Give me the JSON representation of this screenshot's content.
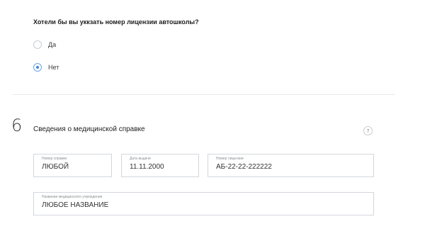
{
  "question": {
    "text": "Хотели бы вы уккзать номер лицензии автошколы?",
    "options": [
      {
        "label": "Да",
        "checked": false
      },
      {
        "label": "Нет",
        "checked": true
      }
    ]
  },
  "section": {
    "number": "6",
    "title": "Сведения о медицинской справке",
    "help_label": "?"
  },
  "fields": {
    "certificate_number": {
      "label": "Номер справки",
      "value": "ЛЮБОЙ"
    },
    "issue_date": {
      "label": "Дата выдачи",
      "value": "11.11.2000"
    },
    "license_number": {
      "label": "Номер лицензии",
      "value": "АБ-22-22-222222"
    },
    "institution_name": {
      "label": "Название медицинского учреждения",
      "value": "ЛЮБОЕ НАЗВАНИЕ"
    }
  },
  "colors": {
    "accent": "#3d87d6",
    "border": "#d3d7dc",
    "divider": "#e7e9ec"
  }
}
